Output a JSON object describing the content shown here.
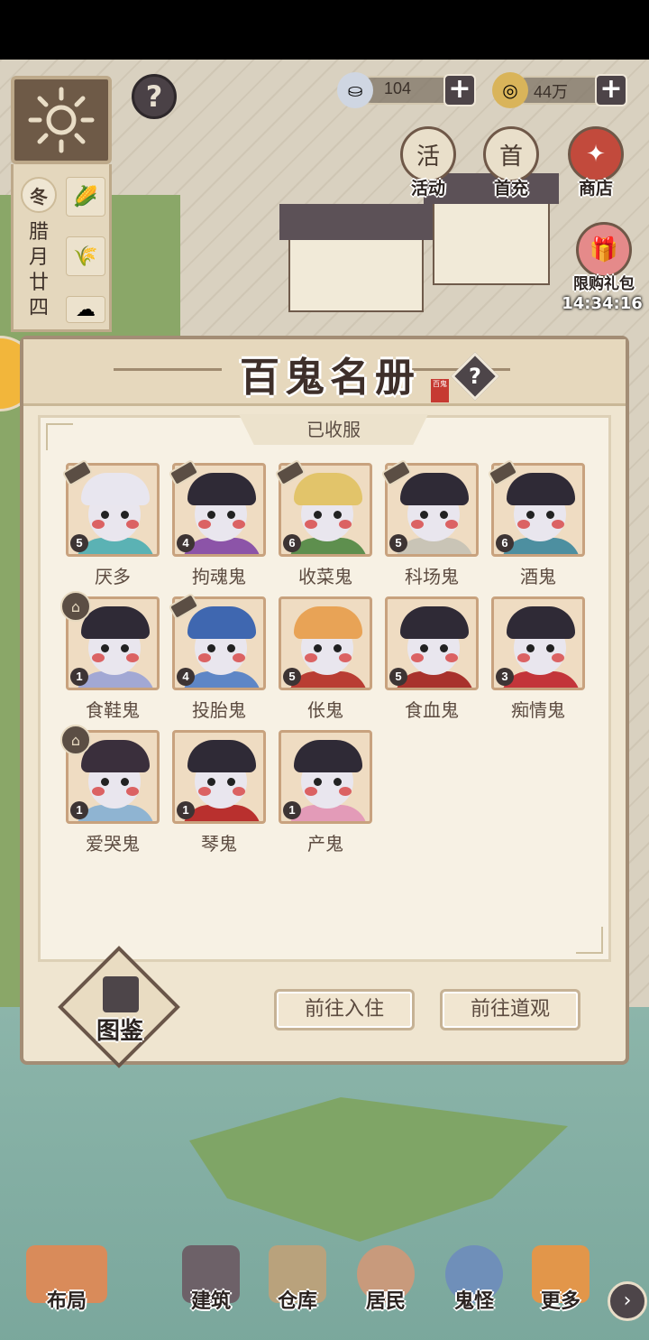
{
  "currencies": {
    "silver": {
      "value": "104",
      "icon": "silver-ingot-icon"
    },
    "coins": {
      "value": "44万",
      "icon": "copper-coin-icon"
    }
  },
  "calendar": {
    "season": "冬",
    "lunar_date": "腊月廿四"
  },
  "top_buttons": {
    "activity": "活动",
    "first_recharge": "首充",
    "shop": "商店",
    "limited_pack": "限购礼包",
    "limited_timer": "14:34:16"
  },
  "modal": {
    "title": "百鬼名册",
    "seal_text": "百鬼",
    "tab_label": "已收服",
    "codex_label": "图鉴",
    "btn_move_in": "前往入住",
    "btn_temple": "前往道观"
  },
  "ghosts": [
    {
      "name": "厌多",
      "level": "5",
      "badge": "hammer",
      "hair": "#e8e6ef",
      "body": "#5bb2b4"
    },
    {
      "name": "拘魂鬼",
      "level": "4",
      "badge": "hammer",
      "hair": "#2f2a36",
      "body": "#8c54a8"
    },
    {
      "name": "收菜鬼",
      "level": "6",
      "badge": "hammer",
      "hair": "#e2c46a",
      "body": "#5e8f4e"
    },
    {
      "name": "科场鬼",
      "level": "5",
      "badge": "hammer",
      "hair": "#2f2a36",
      "body": "#c9c4b6"
    },
    {
      "name": "酒鬼",
      "level": "6",
      "badge": "hammer",
      "hair": "#2f2a36",
      "body": "#4d8fa0"
    },
    {
      "name": "食鞋鬼",
      "level": "1",
      "badge": "pavilion",
      "hair": "#2f2a36",
      "body": "#a2a8d4"
    },
    {
      "name": "投胎鬼",
      "level": "4",
      "badge": "hammer",
      "hair": "#3f67b0",
      "body": "#5e86c6"
    },
    {
      "name": "伥鬼",
      "level": "5",
      "badge": "none",
      "hair": "#e8a356",
      "body": "#b93d33"
    },
    {
      "name": "食血鬼",
      "level": "5",
      "badge": "none",
      "hair": "#2f2a36",
      "body": "#a8322c"
    },
    {
      "name": "痴情鬼",
      "level": "3",
      "badge": "none",
      "hair": "#2f2a36",
      "body": "#c3353a"
    },
    {
      "name": "爱哭鬼",
      "level": "1",
      "badge": "pavilion",
      "hair": "#3a2f3c",
      "body": "#8fb4d2"
    },
    {
      "name": "琴鬼",
      "level": "1",
      "badge": "none",
      "hair": "#2f2a36",
      "body": "#b9302e"
    },
    {
      "name": "产鬼",
      "level": "1",
      "badge": "none",
      "hair": "#2f2a36",
      "body": "#e39bb8"
    }
  ],
  "bottom_nav": {
    "layout": "布局",
    "build": "建筑",
    "warehouse": "仓库",
    "residents": "居民",
    "ghosts": "鬼怪",
    "more": "更多"
  },
  "colors": {
    "modal_bg": "#efe5d0",
    "frame": "#a38d75",
    "accent_dark": "#4d4549"
  }
}
